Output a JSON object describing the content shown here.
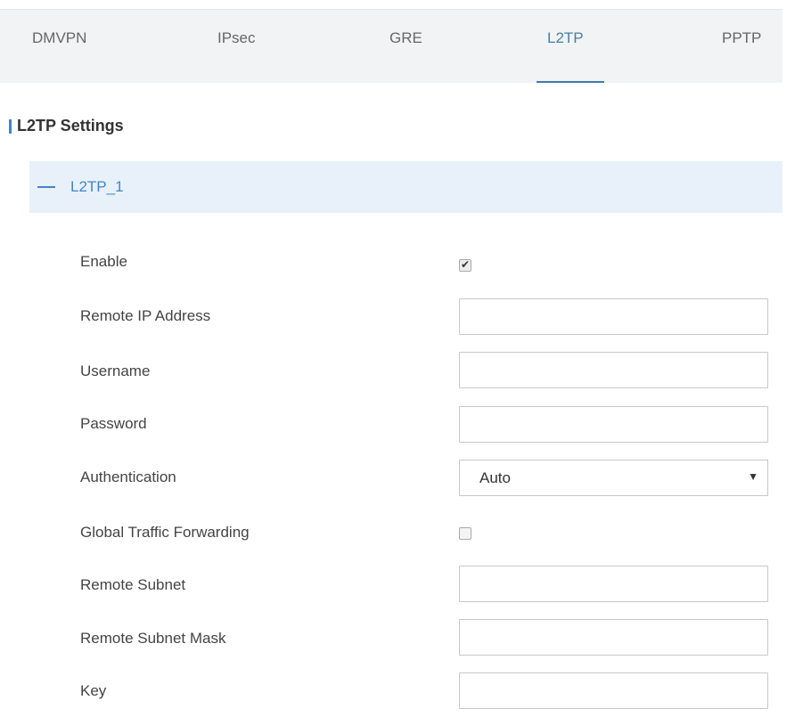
{
  "tabs": [
    {
      "label": "DMVPN",
      "active": false
    },
    {
      "label": "IPsec",
      "active": false
    },
    {
      "label": "GRE",
      "active": false
    },
    {
      "label": "L2TP",
      "active": true
    },
    {
      "label": "PPTP",
      "active": false
    }
  ],
  "section_title": "L2TP Settings",
  "panel": {
    "title": "L2TP_1",
    "expanded": true,
    "collapse_icon": "minus-icon"
  },
  "form": {
    "enable": {
      "label": "Enable",
      "checked": true
    },
    "remote_ip": {
      "label": "Remote IP Address",
      "value": ""
    },
    "username": {
      "label": "Username",
      "value": ""
    },
    "password": {
      "label": "Password",
      "value": ""
    },
    "authentication": {
      "label": "Authentication",
      "value": "Auto"
    },
    "global_traffic_forwarding": {
      "label": "Global Traffic Forwarding",
      "checked": false
    },
    "remote_subnet": {
      "label": "Remote Subnet",
      "value": ""
    },
    "remote_subnet_mask": {
      "label": "Remote Subnet Mask",
      "value": ""
    },
    "key": {
      "label": "Key",
      "value": ""
    }
  },
  "colors": {
    "accent": "#3f86c6",
    "tab_bar_bg": "#f2f3f5",
    "panel_header_bg": "#e8f1f9"
  }
}
